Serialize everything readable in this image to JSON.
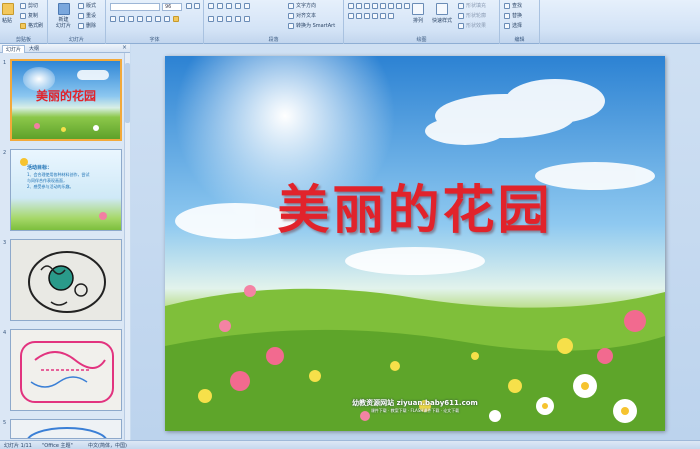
{
  "ribbon": {
    "clipboard": {
      "label": "剪贴板",
      "paste": "粘贴",
      "cut": "剪切",
      "copy": "复制",
      "format_painter": "格式刷"
    },
    "slides": {
      "label": "幻灯片",
      "new_slide": "新建\n幻灯片",
      "layout": "版式",
      "reset": "重设",
      "delete": "删除"
    },
    "font": {
      "label": "字体",
      "font_name": "",
      "font_size": "96"
    },
    "paragraph": {
      "label": "段落",
      "text_direction": "文字方向",
      "align_text": "对齐文本",
      "convert_smartart": "转换为 SmartArt"
    },
    "drawing": {
      "label": "绘图",
      "arrange": "排列",
      "quick_styles": "快速样式",
      "shape_fill": "形状填充",
      "shape_outline": "形状轮廓",
      "shape_effects": "形状效果"
    },
    "editing": {
      "label": "编辑",
      "find": "查找",
      "replace": "替换",
      "select": "选择"
    }
  },
  "pane": {
    "tabs": [
      "幻灯片",
      "大纲"
    ],
    "close": "×",
    "thumbs": [
      {
        "num": "1",
        "title": "美丽的花园"
      },
      {
        "num": "2",
        "heading": "活动目标：",
        "lines": [
          "1、会合理使用各种材料创作，尝试",
          "与同伴合作表现画面，",
          "2、感受参与活动的乐趣。"
        ]
      },
      {
        "num": "3"
      },
      {
        "num": "4"
      },
      {
        "num": "5"
      }
    ]
  },
  "slide": {
    "title": "美丽的花园",
    "caption": "幼教资源网站 ziyuan.baby611.com",
    "caption2": "课件下载 · 教案下载 · FLASH课件下载 · 论文下载"
  },
  "status": {
    "slide_info": "幻灯片 1/11",
    "theme": "\"Office 主题\"",
    "language": "中文(简体，中国)"
  },
  "colors": {
    "title_red": "#e1232b",
    "ribbon_bg": "#d3e3f6",
    "selected_border": "#f3a93a"
  }
}
